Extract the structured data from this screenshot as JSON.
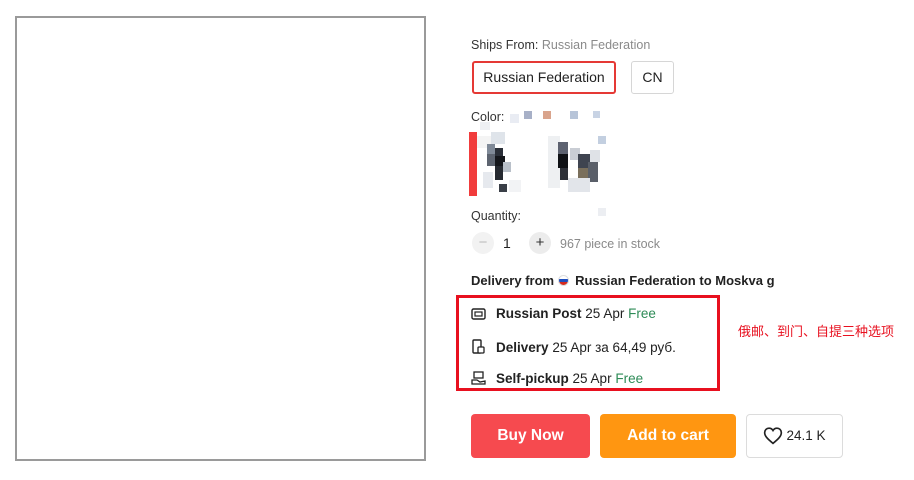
{
  "ships_from": {
    "label": "Ships From:",
    "value": "Russian Federation"
  },
  "ship_options": [
    {
      "label": "Russian Federation",
      "selected": true
    },
    {
      "label": "CN",
      "selected": false
    }
  ],
  "color_label": "Color:",
  "quantity": {
    "label": "Quantity:",
    "value": "1",
    "minus": "−",
    "plus": "+",
    "stock": "967 piece in stock"
  },
  "delivery": {
    "from_label": "Delivery from",
    "from_country": "Russian Federation",
    "to_label": "to",
    "to_city": "Moskva g",
    "options": [
      {
        "icon": "post-icon",
        "name": "Russian Post",
        "date": "25 Apr",
        "price": "Free"
      },
      {
        "icon": "courier-icon",
        "name": "Delivery",
        "date": "25 Apr",
        "price": "за 64,49 руб."
      },
      {
        "icon": "pickup-icon",
        "name": "Self-pickup",
        "date": "25 Apr",
        "price": "Free"
      }
    ]
  },
  "annotation": "俄邮、到门、自提三种选项",
  "actions": {
    "buy_now": "Buy Now",
    "add_to_cart": "Add to cart",
    "wishlist_count": "24.1 K"
  },
  "colors": {
    "accent_red": "#e8101f",
    "buy_now": "#f64a4f",
    "add_to_cart": "#ff9611",
    "free_green": "#2e8b57"
  }
}
